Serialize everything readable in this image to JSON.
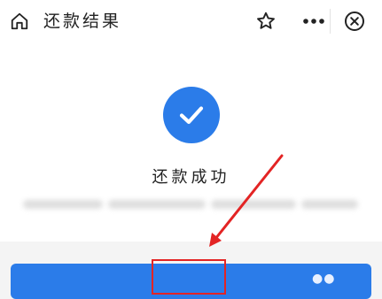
{
  "header": {
    "title": "还款结果",
    "icons": {
      "home": "home-icon",
      "favorite": "star-icon",
      "more": "more-dots-icon",
      "close": "close-circle-icon"
    }
  },
  "result": {
    "status": "还款成功",
    "icon": "check-circle-icon"
  },
  "colors": {
    "accent": "#2b7ce9",
    "annotation": "#e32424"
  }
}
